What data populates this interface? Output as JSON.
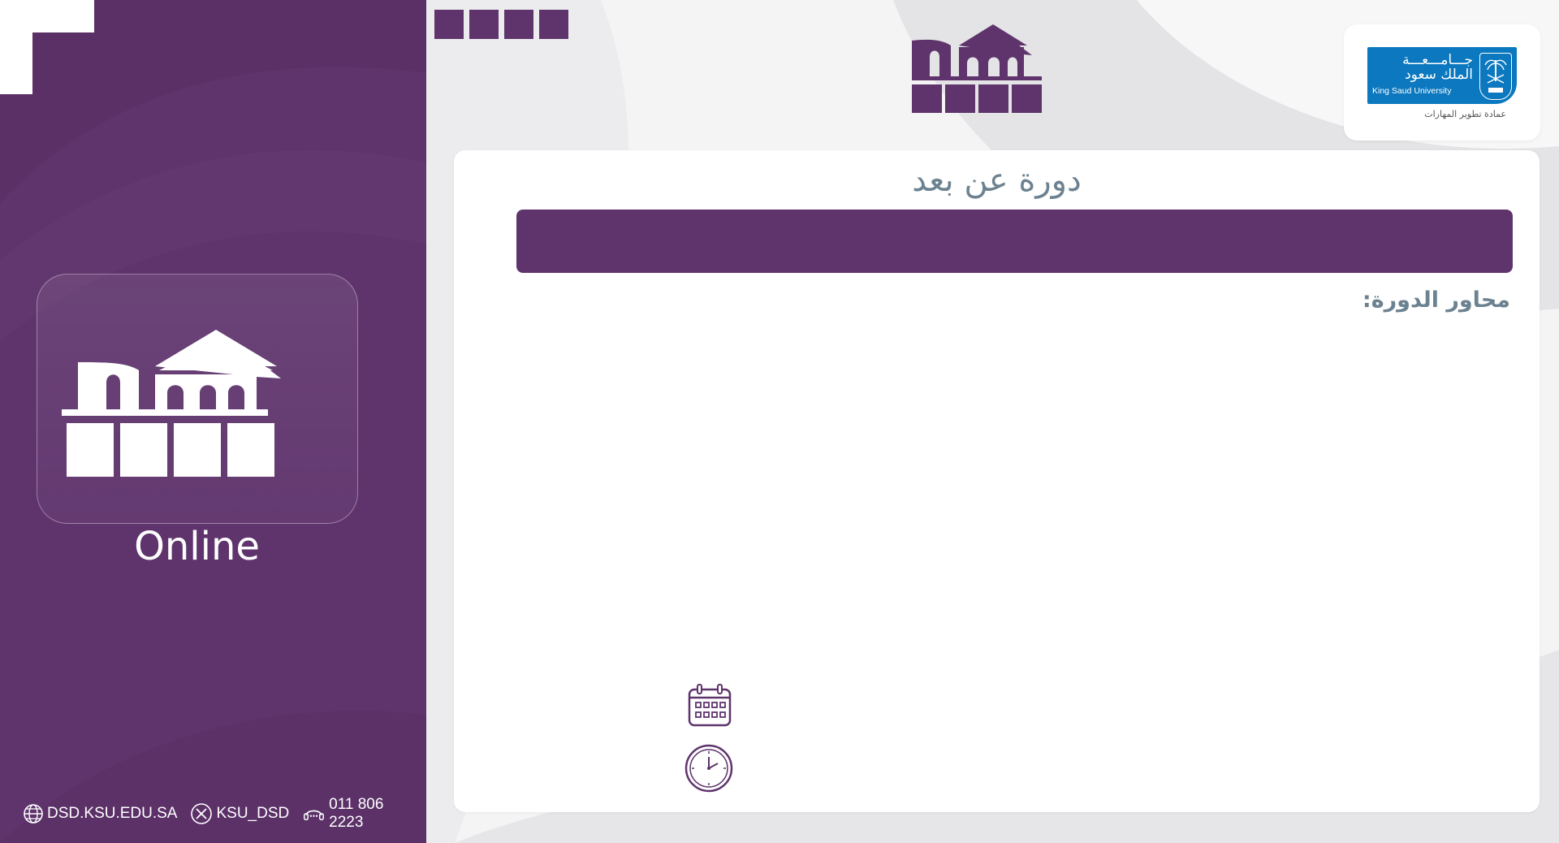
{
  "colors": {
    "primary_purple": "#5f346d",
    "heading_gray": "#6c8290",
    "ksu_blue": "#0b78bf",
    "card_white": "#ffffff"
  },
  "left_panel": {
    "online_label": "Online",
    "logo_icon": "dsd-arches-logo-icon"
  },
  "footer": {
    "website": "DSD.KSU.EDU.SA",
    "social_handle": "KSU_DSD",
    "phone": "011 806 2223",
    "icons": [
      "globe-icon",
      "x-logo-icon",
      "phone-support-icon"
    ]
  },
  "ksu_logo": {
    "arabic_line1": "جـــامـــعـــة",
    "arabic_line2": "الملك سعود",
    "english_name": "King Saud University",
    "department": "عمادة تطوير المهارات"
  },
  "main": {
    "course_type": "دورة عن بعد",
    "title": "",
    "axes_label": "محاور الدورة:",
    "date_icon": "calendar-icon",
    "time_icon": "clock-icon"
  }
}
